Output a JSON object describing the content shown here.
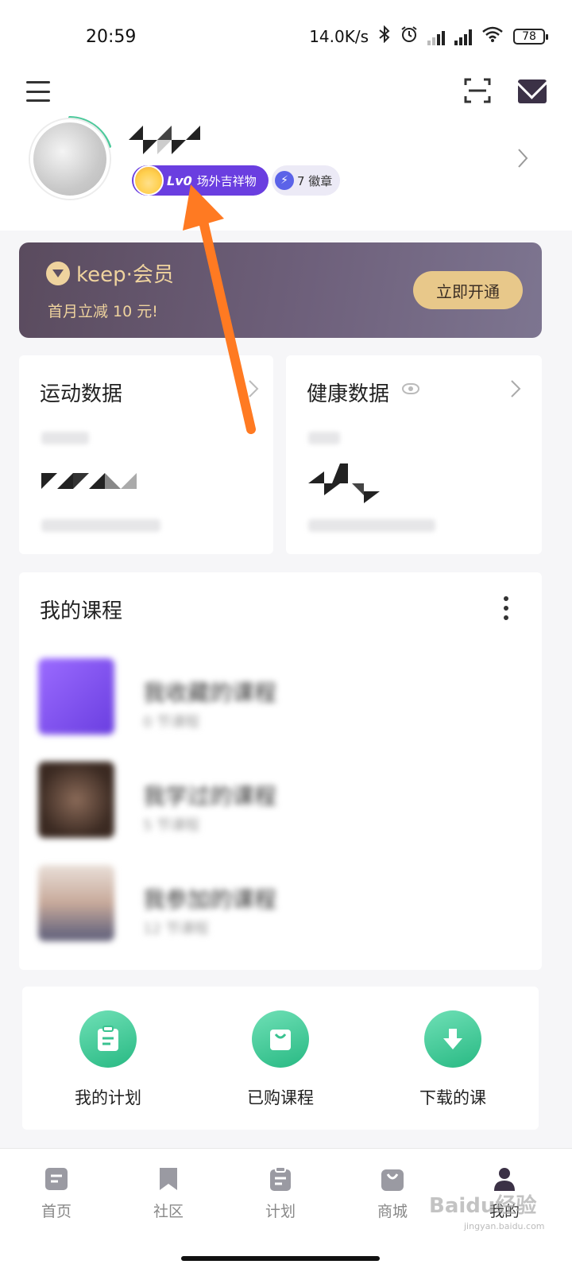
{
  "status_bar": {
    "time": "20:59",
    "net_speed": "14.0K/s",
    "battery": "78"
  },
  "profile": {
    "level": "Lv0",
    "level_title": "场外吉祥物",
    "badges": "7 徽章"
  },
  "member": {
    "brand": "keep·会员",
    "promo": "首月立减 10 元!",
    "cta": "立即开通",
    "colors": {
      "gold": "#efd39e",
      "button": "#e8c88a"
    }
  },
  "sport_data": {
    "title": "运动数据"
  },
  "health_data": {
    "title": "健康数据"
  },
  "courses": {
    "title": "我的课程",
    "items": [
      {
        "name": "我收藏的课程",
        "count": "0 节课程"
      },
      {
        "name": "我学过的课程",
        "count": "5 节课程"
      },
      {
        "name": "我参加的课程",
        "count": "12 节课程"
      }
    ]
  },
  "shortcuts": [
    {
      "label": "我的计划",
      "icon": "plan-clipboard-icon"
    },
    {
      "label": "已购课程",
      "icon": "shopping-bag-icon"
    },
    {
      "label": "下载的课",
      "icon": "download-arrow-icon"
    }
  ],
  "tabs": [
    {
      "label": "首页",
      "icon": "home-icon"
    },
    {
      "label": "社区",
      "icon": "bookmark-icon"
    },
    {
      "label": "计划",
      "icon": "plan-icon"
    },
    {
      "label": "商城",
      "icon": "store-bag-icon"
    },
    {
      "label": "我的",
      "icon": "person-icon",
      "active": true
    }
  ],
  "watermark": {
    "brand": "Baidu经验",
    "url": "jingyan.baidu.com"
  },
  "accent_colors": {
    "level_purple": "#6a3ee0",
    "green": "#28b983",
    "annotation_arrow": "#ff7a22"
  }
}
